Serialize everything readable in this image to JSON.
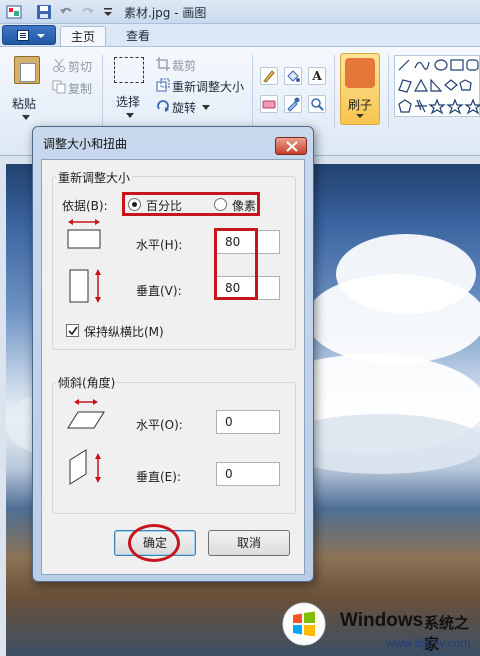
{
  "window": {
    "title": "素材.jpg - 画图"
  },
  "tabs": [
    {
      "label": "主页"
    },
    {
      "label": "查看"
    }
  ],
  "ribbon": {
    "paste": "粘贴",
    "cut": "剪切",
    "copy": "复制",
    "select": "选择",
    "crop": "裁剪",
    "resize": "重新调整大小",
    "rotate": "旋转",
    "brushes": "刷子",
    "text_tool": "A"
  },
  "dialog": {
    "title": "调整大小和扭曲",
    "resize_group": {
      "title": "重新调整大小",
      "by_label": "依据(B):",
      "option_percent": "百分比",
      "option_pixels": "像素",
      "selected": "百分比",
      "horizontal_label": "水平(H):",
      "horizontal_value": "80",
      "vertical_label": "垂直(V):",
      "vertical_value": "80",
      "keep_ratio_label": "保持纵横比(M)",
      "keep_ratio_checked": true
    },
    "skew_group": {
      "title": "倾斜(角度)",
      "horizontal_label": "水平(O):",
      "horizontal_value": "0",
      "vertical_label": "垂直(E):",
      "vertical_value": "0"
    },
    "ok": "确定",
    "cancel": "取消"
  },
  "watermark": {
    "brand": "Windows",
    "brand_cn": "系统之家",
    "url": "www.bjjmlv.com"
  },
  "colors": {
    "highlight": "#c8141c",
    "ribbon_accent": "#f7c44f"
  }
}
